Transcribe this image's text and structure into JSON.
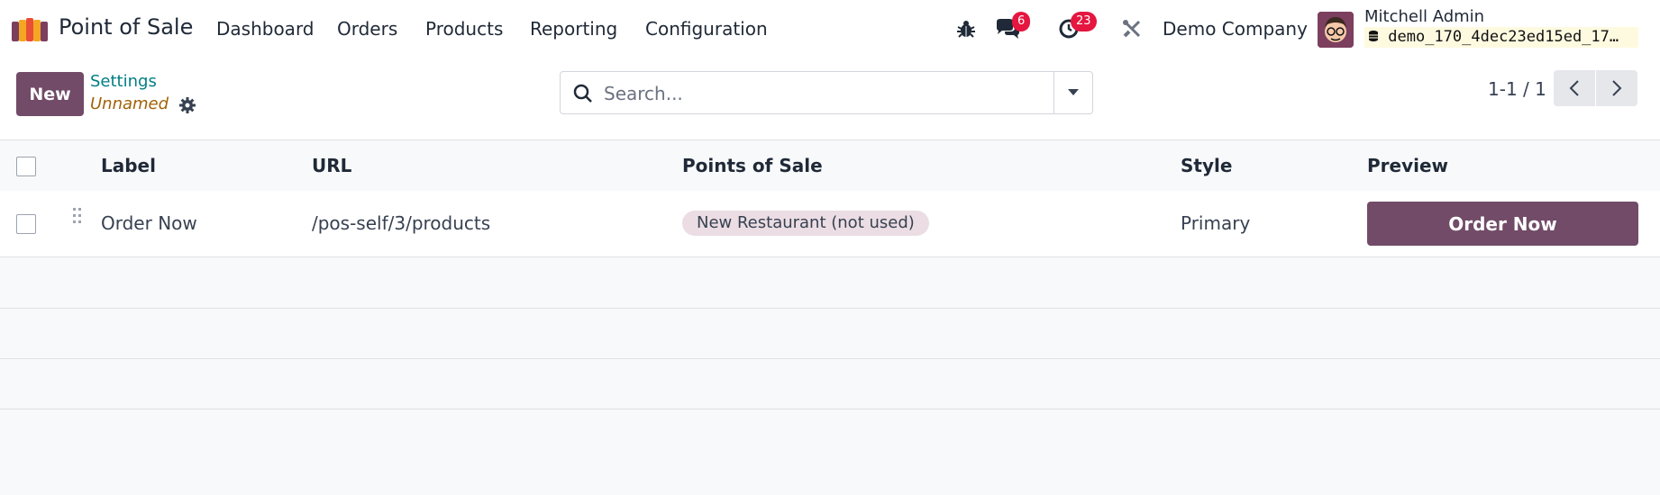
{
  "navbar": {
    "app_name": "Point of Sale",
    "menu": [
      "Dashboard",
      "Orders",
      "Products",
      "Reporting",
      "Configuration"
    ],
    "messages_count": "6",
    "activities_count": "23",
    "company": "Demo Company",
    "user_name": "Mitchell Admin",
    "database": "demo_170_4dec23ed15ed_17…"
  },
  "control_panel": {
    "new_label": "New",
    "breadcrumb_parent": "Settings",
    "breadcrumb_current": "Unnamed",
    "search_placeholder": "Search...",
    "pager_value": "1-1 / 1"
  },
  "table": {
    "columns": [
      "Label",
      "URL",
      "Points of Sale",
      "Style",
      "Preview"
    ],
    "rows": [
      {
        "label": "Order Now",
        "url": "/pos-self/3/products",
        "points_of_sale": "New Restaurant (not used)",
        "style": "Primary",
        "preview": "Order Now"
      }
    ]
  },
  "colors": {
    "brand": "#714B67",
    "badge": "#e5163f",
    "breadcrumb_link": "#017e84",
    "tag_bg": "#ebdde3"
  },
  "icons": [
    "app-logo-icon",
    "bug-icon",
    "chat-icon",
    "clock-icon",
    "tools-icon",
    "database-icon",
    "gear-icon",
    "search-icon",
    "caret-down-icon",
    "chevron-left-icon",
    "chevron-right-icon",
    "drag-handle-icon"
  ]
}
